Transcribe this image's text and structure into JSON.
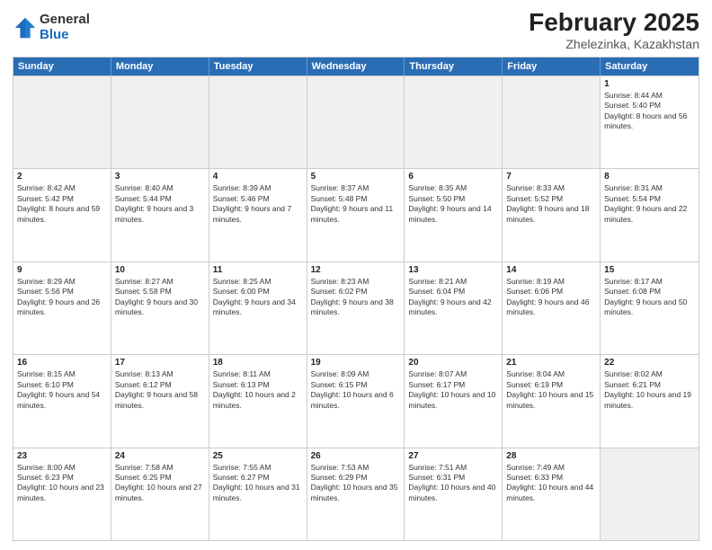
{
  "logo": {
    "general": "General",
    "blue": "Blue"
  },
  "title": "February 2025",
  "subtitle": "Zhelezinka, Kazakhstan",
  "header_days": [
    "Sunday",
    "Monday",
    "Tuesday",
    "Wednesday",
    "Thursday",
    "Friday",
    "Saturday"
  ],
  "weeks": [
    [
      {
        "day": "",
        "info": "",
        "shaded": true
      },
      {
        "day": "",
        "info": "",
        "shaded": true
      },
      {
        "day": "",
        "info": "",
        "shaded": true
      },
      {
        "day": "",
        "info": "",
        "shaded": true
      },
      {
        "day": "",
        "info": "",
        "shaded": true
      },
      {
        "day": "",
        "info": "",
        "shaded": true
      },
      {
        "day": "1",
        "info": "Sunrise: 8:44 AM\nSunset: 5:40 PM\nDaylight: 8 hours and 56 minutes."
      }
    ],
    [
      {
        "day": "2",
        "info": "Sunrise: 8:42 AM\nSunset: 5:42 PM\nDaylight: 8 hours and 59 minutes."
      },
      {
        "day": "3",
        "info": "Sunrise: 8:40 AM\nSunset: 5:44 PM\nDaylight: 9 hours and 3 minutes."
      },
      {
        "day": "4",
        "info": "Sunrise: 8:39 AM\nSunset: 5:46 PM\nDaylight: 9 hours and 7 minutes."
      },
      {
        "day": "5",
        "info": "Sunrise: 8:37 AM\nSunset: 5:48 PM\nDaylight: 9 hours and 11 minutes."
      },
      {
        "day": "6",
        "info": "Sunrise: 8:35 AM\nSunset: 5:50 PM\nDaylight: 9 hours and 14 minutes."
      },
      {
        "day": "7",
        "info": "Sunrise: 8:33 AM\nSunset: 5:52 PM\nDaylight: 9 hours and 18 minutes."
      },
      {
        "day": "8",
        "info": "Sunrise: 8:31 AM\nSunset: 5:54 PM\nDaylight: 9 hours and 22 minutes."
      }
    ],
    [
      {
        "day": "9",
        "info": "Sunrise: 8:29 AM\nSunset: 5:56 PM\nDaylight: 9 hours and 26 minutes."
      },
      {
        "day": "10",
        "info": "Sunrise: 8:27 AM\nSunset: 5:58 PM\nDaylight: 9 hours and 30 minutes."
      },
      {
        "day": "11",
        "info": "Sunrise: 8:25 AM\nSunset: 6:00 PM\nDaylight: 9 hours and 34 minutes."
      },
      {
        "day": "12",
        "info": "Sunrise: 8:23 AM\nSunset: 6:02 PM\nDaylight: 9 hours and 38 minutes."
      },
      {
        "day": "13",
        "info": "Sunrise: 8:21 AM\nSunset: 6:04 PM\nDaylight: 9 hours and 42 minutes."
      },
      {
        "day": "14",
        "info": "Sunrise: 8:19 AM\nSunset: 6:06 PM\nDaylight: 9 hours and 46 minutes."
      },
      {
        "day": "15",
        "info": "Sunrise: 8:17 AM\nSunset: 6:08 PM\nDaylight: 9 hours and 50 minutes."
      }
    ],
    [
      {
        "day": "16",
        "info": "Sunrise: 8:15 AM\nSunset: 6:10 PM\nDaylight: 9 hours and 54 minutes."
      },
      {
        "day": "17",
        "info": "Sunrise: 8:13 AM\nSunset: 6:12 PM\nDaylight: 9 hours and 58 minutes."
      },
      {
        "day": "18",
        "info": "Sunrise: 8:11 AM\nSunset: 6:13 PM\nDaylight: 10 hours and 2 minutes."
      },
      {
        "day": "19",
        "info": "Sunrise: 8:09 AM\nSunset: 6:15 PM\nDaylight: 10 hours and 6 minutes."
      },
      {
        "day": "20",
        "info": "Sunrise: 8:07 AM\nSunset: 6:17 PM\nDaylight: 10 hours and 10 minutes."
      },
      {
        "day": "21",
        "info": "Sunrise: 8:04 AM\nSunset: 6:19 PM\nDaylight: 10 hours and 15 minutes."
      },
      {
        "day": "22",
        "info": "Sunrise: 8:02 AM\nSunset: 6:21 PM\nDaylight: 10 hours and 19 minutes."
      }
    ],
    [
      {
        "day": "23",
        "info": "Sunrise: 8:00 AM\nSunset: 6:23 PM\nDaylight: 10 hours and 23 minutes."
      },
      {
        "day": "24",
        "info": "Sunrise: 7:58 AM\nSunset: 6:25 PM\nDaylight: 10 hours and 27 minutes."
      },
      {
        "day": "25",
        "info": "Sunrise: 7:55 AM\nSunset: 6:27 PM\nDaylight: 10 hours and 31 minutes."
      },
      {
        "day": "26",
        "info": "Sunrise: 7:53 AM\nSunset: 6:29 PM\nDaylight: 10 hours and 35 minutes."
      },
      {
        "day": "27",
        "info": "Sunrise: 7:51 AM\nSunset: 6:31 PM\nDaylight: 10 hours and 40 minutes."
      },
      {
        "day": "28",
        "info": "Sunrise: 7:49 AM\nSunset: 6:33 PM\nDaylight: 10 hours and 44 minutes."
      },
      {
        "day": "",
        "info": "",
        "shaded": true
      }
    ]
  ]
}
